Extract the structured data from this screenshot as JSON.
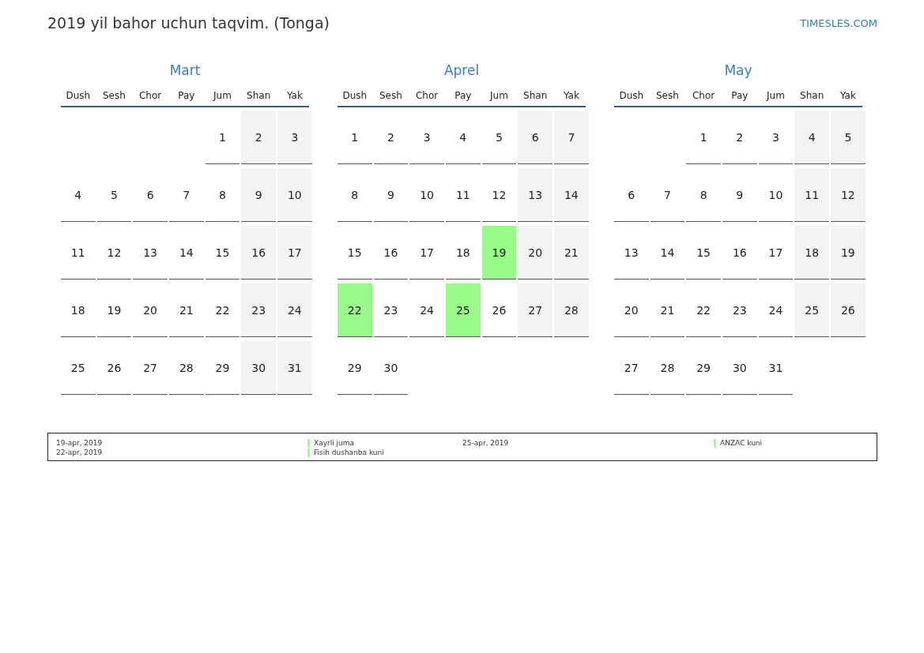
{
  "title": "2019 yil bahor uchun taqvim. (Tonga)",
  "site_link": "TIMESLES.COM",
  "months": [
    {
      "name": "Mart",
      "weekdays": [
        {
          "label": "Dush",
          "weekend": false
        },
        {
          "label": "Sesh",
          "weekend": false
        },
        {
          "label": "Chor",
          "weekend": false
        },
        {
          "label": "Pay",
          "weekend": false
        },
        {
          "label": "Jum",
          "weekend": false
        },
        {
          "label": "Shan",
          "weekend": true
        },
        {
          "label": "Yak",
          "weekend": true
        }
      ],
      "weeks": [
        [
          {
            "kind": "blank"
          },
          {
            "kind": "blank"
          },
          {
            "kind": "blank"
          },
          {
            "kind": "blank"
          },
          {
            "kind": "day",
            "day": "1",
            "holiday": false
          },
          {
            "kind": "day",
            "day": "2",
            "holiday": false
          },
          {
            "kind": "day",
            "day": "3",
            "holiday": false
          }
        ],
        [
          {
            "kind": "day",
            "day": "4",
            "holiday": false
          },
          {
            "kind": "day",
            "day": "5",
            "holiday": false
          },
          {
            "kind": "day",
            "day": "6",
            "holiday": false
          },
          {
            "kind": "day",
            "day": "7",
            "holiday": false
          },
          {
            "kind": "day",
            "day": "8",
            "holiday": false
          },
          {
            "kind": "day",
            "day": "9",
            "holiday": false
          },
          {
            "kind": "day",
            "day": "10",
            "holiday": false
          }
        ],
        [
          {
            "kind": "day",
            "day": "11",
            "holiday": false
          },
          {
            "kind": "day",
            "day": "12",
            "holiday": false
          },
          {
            "kind": "day",
            "day": "13",
            "holiday": false
          },
          {
            "kind": "day",
            "day": "14",
            "holiday": false
          },
          {
            "kind": "day",
            "day": "15",
            "holiday": false
          },
          {
            "kind": "day",
            "day": "16",
            "holiday": false
          },
          {
            "kind": "day",
            "day": "17",
            "holiday": false
          }
        ],
        [
          {
            "kind": "day",
            "day": "18",
            "holiday": false
          },
          {
            "kind": "day",
            "day": "19",
            "holiday": false
          },
          {
            "kind": "day",
            "day": "20",
            "holiday": false
          },
          {
            "kind": "day",
            "day": "21",
            "holiday": false
          },
          {
            "kind": "day",
            "day": "22",
            "holiday": false
          },
          {
            "kind": "day",
            "day": "23",
            "holiday": false
          },
          {
            "kind": "day",
            "day": "24",
            "holiday": false
          }
        ],
        [
          {
            "kind": "day",
            "day": "25",
            "holiday": false
          },
          {
            "kind": "day",
            "day": "26",
            "holiday": false
          },
          {
            "kind": "day",
            "day": "27",
            "holiday": false
          },
          {
            "kind": "day",
            "day": "28",
            "holiday": false
          },
          {
            "kind": "day",
            "day": "29",
            "holiday": false
          },
          {
            "kind": "day",
            "day": "30",
            "holiday": false
          },
          {
            "kind": "day",
            "day": "31",
            "holiday": false
          }
        ]
      ]
    },
    {
      "name": "Aprel",
      "weekdays": [
        {
          "label": "Dush",
          "weekend": false
        },
        {
          "label": "Sesh",
          "weekend": false
        },
        {
          "label": "Chor",
          "weekend": false
        },
        {
          "label": "Pay",
          "weekend": false
        },
        {
          "label": "Jum",
          "weekend": false
        },
        {
          "label": "Shan",
          "weekend": true
        },
        {
          "label": "Yak",
          "weekend": true
        }
      ],
      "weeks": [
        [
          {
            "kind": "day",
            "day": "1",
            "holiday": false
          },
          {
            "kind": "day",
            "day": "2",
            "holiday": false
          },
          {
            "kind": "day",
            "day": "3",
            "holiday": false
          },
          {
            "kind": "day",
            "day": "4",
            "holiday": false
          },
          {
            "kind": "day",
            "day": "5",
            "holiday": false
          },
          {
            "kind": "day",
            "day": "6",
            "holiday": false
          },
          {
            "kind": "day",
            "day": "7",
            "holiday": false
          }
        ],
        [
          {
            "kind": "day",
            "day": "8",
            "holiday": false
          },
          {
            "kind": "day",
            "day": "9",
            "holiday": false
          },
          {
            "kind": "day",
            "day": "10",
            "holiday": false
          },
          {
            "kind": "day",
            "day": "11",
            "holiday": false
          },
          {
            "kind": "day",
            "day": "12",
            "holiday": false
          },
          {
            "kind": "day",
            "day": "13",
            "holiday": false
          },
          {
            "kind": "day",
            "day": "14",
            "holiday": false
          }
        ],
        [
          {
            "kind": "day",
            "day": "15",
            "holiday": false
          },
          {
            "kind": "day",
            "day": "16",
            "holiday": false
          },
          {
            "kind": "day",
            "day": "17",
            "holiday": false
          },
          {
            "kind": "day",
            "day": "18",
            "holiday": false
          },
          {
            "kind": "day",
            "day": "19",
            "holiday": true
          },
          {
            "kind": "day",
            "day": "20",
            "holiday": false
          },
          {
            "kind": "day",
            "day": "21",
            "holiday": false
          }
        ],
        [
          {
            "kind": "day",
            "day": "22",
            "holiday": true
          },
          {
            "kind": "day",
            "day": "23",
            "holiday": false
          },
          {
            "kind": "day",
            "day": "24",
            "holiday": false
          },
          {
            "kind": "day",
            "day": "25",
            "holiday": true
          },
          {
            "kind": "day",
            "day": "26",
            "holiday": false
          },
          {
            "kind": "day",
            "day": "27",
            "holiday": false
          },
          {
            "kind": "day",
            "day": "28",
            "holiday": false
          }
        ],
        [
          {
            "kind": "day",
            "day": "29",
            "holiday": false
          },
          {
            "kind": "day",
            "day": "30",
            "holiday": false
          },
          {
            "kind": "blank"
          },
          {
            "kind": "blank"
          },
          {
            "kind": "blank"
          },
          {
            "kind": "blank"
          },
          {
            "kind": "blank"
          }
        ]
      ]
    },
    {
      "name": "May",
      "weekdays": [
        {
          "label": "Dush",
          "weekend": false
        },
        {
          "label": "Sesh",
          "weekend": false
        },
        {
          "label": "Chor",
          "weekend": false
        },
        {
          "label": "Pay",
          "weekend": false
        },
        {
          "label": "Jum",
          "weekend": false
        },
        {
          "label": "Shan",
          "weekend": true
        },
        {
          "label": "Yak",
          "weekend": true
        }
      ],
      "weeks": [
        [
          {
            "kind": "blank"
          },
          {
            "kind": "blank"
          },
          {
            "kind": "day",
            "day": "1",
            "holiday": false
          },
          {
            "kind": "day",
            "day": "2",
            "holiday": false
          },
          {
            "kind": "day",
            "day": "3",
            "holiday": false
          },
          {
            "kind": "day",
            "day": "4",
            "holiday": false
          },
          {
            "kind": "day",
            "day": "5",
            "holiday": false
          }
        ],
        [
          {
            "kind": "day",
            "day": "6",
            "holiday": false
          },
          {
            "kind": "day",
            "day": "7",
            "holiday": false
          },
          {
            "kind": "day",
            "day": "8",
            "holiday": false
          },
          {
            "kind": "day",
            "day": "9",
            "holiday": false
          },
          {
            "kind": "day",
            "day": "10",
            "holiday": false
          },
          {
            "kind": "day",
            "day": "11",
            "holiday": false
          },
          {
            "kind": "day",
            "day": "12",
            "holiday": false
          }
        ],
        [
          {
            "kind": "day",
            "day": "13",
            "holiday": false
          },
          {
            "kind": "day",
            "day": "14",
            "holiday": false
          },
          {
            "kind": "day",
            "day": "15",
            "holiday": false
          },
          {
            "kind": "day",
            "day": "16",
            "holiday": false
          },
          {
            "kind": "day",
            "day": "17",
            "holiday": false
          },
          {
            "kind": "day",
            "day": "18",
            "holiday": false
          },
          {
            "kind": "day",
            "day": "19",
            "holiday": false
          }
        ],
        [
          {
            "kind": "day",
            "day": "20",
            "holiday": false
          },
          {
            "kind": "day",
            "day": "21",
            "holiday": false
          },
          {
            "kind": "day",
            "day": "22",
            "holiday": false
          },
          {
            "kind": "day",
            "day": "23",
            "holiday": false
          },
          {
            "kind": "day",
            "day": "24",
            "holiday": false
          },
          {
            "kind": "day",
            "day": "25",
            "holiday": false
          },
          {
            "kind": "day",
            "day": "26",
            "holiday": false
          }
        ],
        [
          {
            "kind": "day",
            "day": "27",
            "holiday": false
          },
          {
            "kind": "day",
            "day": "28",
            "holiday": false
          },
          {
            "kind": "day",
            "day": "29",
            "holiday": false
          },
          {
            "kind": "day",
            "day": "30",
            "holiday": false
          },
          {
            "kind": "day",
            "day": "31",
            "holiday": false
          },
          {
            "kind": "blank"
          },
          {
            "kind": "blank"
          }
        ]
      ]
    }
  ],
  "legend": [
    [
      {
        "date": "19-apr, 2019",
        "name": "Xayrli juma",
        "color": "#99ff88"
      },
      {
        "date": "22-apr, 2019",
        "name": "Fisih dushanba kuni",
        "color": "#99ff88"
      }
    ],
    [
      {
        "date": "25-apr, 2019",
        "name": "ANZAC kuni",
        "color": "#99ff88"
      }
    ]
  ]
}
